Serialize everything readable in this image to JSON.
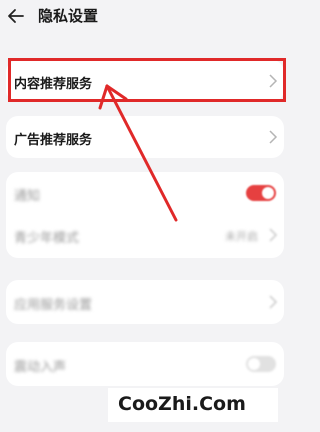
{
  "header": {
    "title": "隐私设置"
  },
  "rows": [
    {
      "label": "内容推荐服务"
    },
    {
      "label": "广告推荐服务"
    },
    {
      "label": "通知",
      "toggle": "on"
    },
    {
      "label": "青少年模式",
      "value": "未开启"
    },
    {
      "label": "应用服务设置"
    },
    {
      "label": "震动入声",
      "toggle": "off"
    }
  ],
  "watermark": "CooZhi.Com",
  "colors": {
    "accent": "#e02929",
    "background": "#f3f3f5",
    "card": "#ffffff"
  }
}
